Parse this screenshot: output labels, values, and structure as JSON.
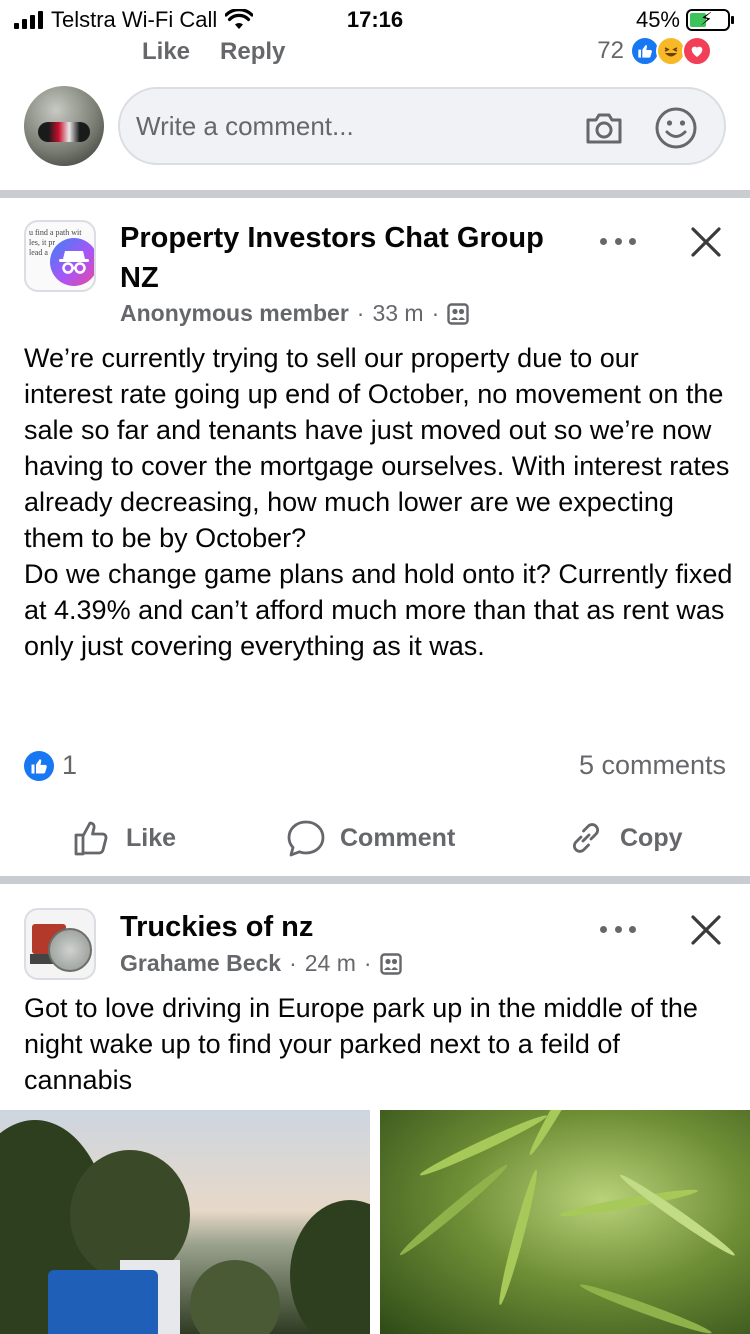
{
  "status_bar": {
    "carrier": "Telstra Wi-Fi Call",
    "time": "17:16",
    "battery_text": "45%",
    "battery_level": 0.45,
    "icons": [
      "signal-icon",
      "wifi-icon",
      "battery-icon"
    ]
  },
  "previous_comment": {
    "like_label": "Like",
    "reply_label": "Reply",
    "reaction_count": "72",
    "reactions": [
      "like",
      "haha",
      "love"
    ]
  },
  "composer": {
    "placeholder": "Write a comment...",
    "icons": [
      "camera-icon",
      "emoji-icon"
    ]
  },
  "posts": [
    {
      "group": "Property Investors Chat Group NZ",
      "author": "Anonymous member",
      "time": "33 m",
      "separator": "·",
      "body": "We’re currently trying to sell our property due to our interest rate going up end of October, no movement on the sale so far and tenants have just moved out so we’re now having to cover the mortgage ourselves. With interest rates already decreasing, how much lower are we expecting them to be by October?\nDo we change game plans and hold onto it? Currently fixed at 4.39% and can’t afford much more than that as rent was only just covering everything as it was.",
      "avatar_text": "u find a path wit\nles, it pr\nlead a",
      "like_count": "1",
      "comments": "5 comments",
      "actions": {
        "like": "Like",
        "comment": "Comment",
        "copy": "Copy"
      }
    },
    {
      "group": "Truckies of nz",
      "author": "Grahame Beck",
      "time": "24 m",
      "separator": "·",
      "body": "Got to love driving in Europe park up in the middle of the night wake up to find your parked next to a feild of cannabis"
    }
  ],
  "colors": {
    "accent": "#1877f2",
    "text_secondary": "#65676b",
    "divider": "#c9ccd1"
  }
}
